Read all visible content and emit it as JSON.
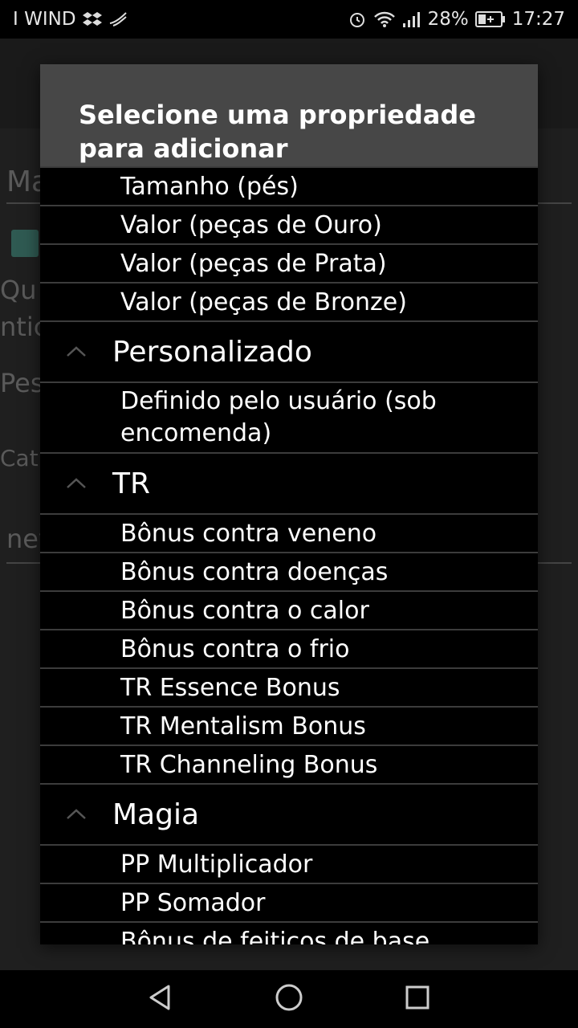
{
  "status_bar": {
    "carrier": "I WIND",
    "battery": "28%",
    "time": "17:27"
  },
  "background": {
    "field1": "Ma",
    "label_qu": "Qu",
    "label_ntic": "ntic",
    "label_pes": "Pes",
    "label_cat": "Cat",
    "field_nev": "nev"
  },
  "dialog": {
    "title": "Selecione uma propriedade para adicionar",
    "rows": [
      {
        "type": "item",
        "label": "Tamanho (pés)"
      },
      {
        "type": "item",
        "label": "Valor (peças de Ouro)"
      },
      {
        "type": "item",
        "label": "Valor (peças de Prata)"
      },
      {
        "type": "item",
        "label": "Valor (peças de Bronze)"
      },
      {
        "type": "group",
        "label": "Personalizado"
      },
      {
        "type": "item",
        "label": "Definido pelo usuário (sob encomenda)"
      },
      {
        "type": "group",
        "label": "TR"
      },
      {
        "type": "item",
        "label": "Bônus contra veneno"
      },
      {
        "type": "item",
        "label": "Bônus contra doenças"
      },
      {
        "type": "item",
        "label": "Bônus contra o calor"
      },
      {
        "type": "item",
        "label": "Bônus contra o frio"
      },
      {
        "type": "item",
        "label": "TR Essence Bonus"
      },
      {
        "type": "item",
        "label": "TR Mentalism Bonus"
      },
      {
        "type": "item",
        "label": "TR Channeling Bonus"
      },
      {
        "type": "group",
        "label": "Magia"
      },
      {
        "type": "item",
        "label": "PP Multiplicador"
      },
      {
        "type": "item",
        "label": "PP Somador"
      },
      {
        "type": "item",
        "label": "Bônus de feitiços de base"
      }
    ]
  },
  "nav": {
    "back": "back-icon",
    "home": "home-icon",
    "recents": "recents-icon"
  }
}
